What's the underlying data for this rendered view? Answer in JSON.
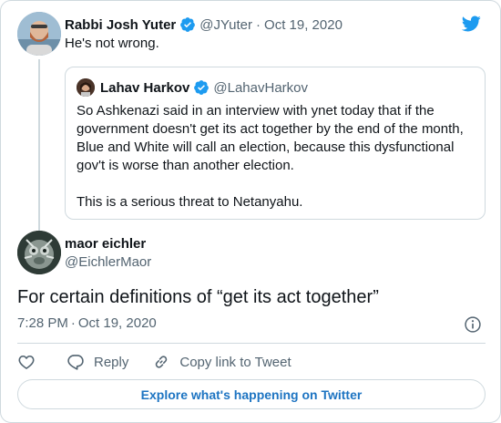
{
  "parent_tweet": {
    "author_name": "Rabbi Josh Yuter",
    "handle": "@JYuter",
    "separator": "·",
    "date": "Oct 19, 2020",
    "text": "He's not wrong."
  },
  "quoted_tweet": {
    "author_name": "Lahav Harkov",
    "handle": "@LahavHarkov",
    "paragraph_1": "So Ashkenazi said in an interview with ynet today that if the government doesn't get its act together by the end of the month, Blue and White will call an election, because this dysfunctional gov't is worse than another election.",
    "paragraph_2": "This is a serious threat to Netanyahu."
  },
  "main_tweet": {
    "author_name": "maor eichler",
    "handle": "@EichlerMaor",
    "text": "For certain definitions of “get its act together”",
    "time": "7:28 PM",
    "separator": "·",
    "date": "Oct 19, 2020"
  },
  "actions": {
    "reply_label": "Reply",
    "copy_link_label": "Copy link to Tweet"
  },
  "explore_label": "Explore what's happening on Twitter",
  "colors": {
    "twitter_blue": "#1d9bf0",
    "link_blue": "#1d74c2",
    "text_secondary": "#536471",
    "border": "#cfd9de"
  },
  "icons": [
    "twitter-bird-icon",
    "verified-badge-icon",
    "info-icon",
    "heart-icon",
    "reply-icon",
    "link-icon"
  ]
}
